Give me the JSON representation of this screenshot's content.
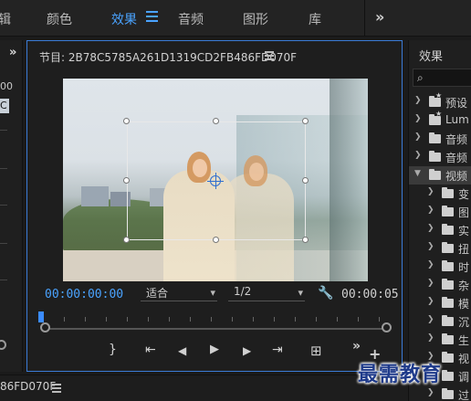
{
  "workspaces": {
    "partial_left": "辑",
    "items": [
      "颜色",
      "效果",
      "音频",
      "图形",
      "库"
    ],
    "active": "效果",
    "more": "»"
  },
  "left_panel": {
    "chevron": "»",
    "number_fragment": "00",
    "selected_fragment": "C"
  },
  "monitor": {
    "title": "节目: 2B78C5785A261D1319CD2FB486FD070F",
    "timecode_current": "00:00:00:00",
    "fit_label": "适合",
    "resolution_label": "1/2",
    "timecode_duration": "00:00:05",
    "controls": {
      "mark_in": "{",
      "mark_out": "}",
      "go_to_in": "⇤",
      "step_back": "◀",
      "play": "▶",
      "step_forward": "▶",
      "go_to_out": "⇥",
      "export_frame": "⊞",
      "more": "»",
      "add": "+"
    }
  },
  "bottom": {
    "sequence_label": "86FD070F"
  },
  "effects_panel": {
    "title": "效果",
    "search_icon": "⌕",
    "items": [
      {
        "label": "预设",
        "level": 0,
        "expanded": false,
        "icon": "star-folder"
      },
      {
        "label": "Lum",
        "level": 0,
        "expanded": false,
        "icon": "star-folder"
      },
      {
        "label": "音频",
        "level": 0,
        "expanded": false,
        "icon": "folder"
      },
      {
        "label": "音频",
        "level": 0,
        "expanded": false,
        "icon": "folder"
      },
      {
        "label": "视频",
        "level": 0,
        "expanded": true,
        "icon": "folder"
      },
      {
        "label": "变",
        "level": 1,
        "expanded": false,
        "icon": "folder"
      },
      {
        "label": "图",
        "level": 1,
        "expanded": false,
        "icon": "folder"
      },
      {
        "label": "实",
        "level": 1,
        "expanded": false,
        "icon": "folder"
      },
      {
        "label": "扭",
        "level": 1,
        "expanded": false,
        "icon": "folder"
      },
      {
        "label": "时",
        "level": 1,
        "expanded": false,
        "icon": "folder"
      },
      {
        "label": "杂",
        "level": 1,
        "expanded": false,
        "icon": "folder"
      },
      {
        "label": "模",
        "level": 1,
        "expanded": false,
        "icon": "folder"
      },
      {
        "label": "沉",
        "level": 1,
        "expanded": false,
        "icon": "folder"
      },
      {
        "label": "生",
        "level": 1,
        "expanded": false,
        "icon": "folder"
      },
      {
        "label": "视",
        "level": 1,
        "expanded": false,
        "icon": "folder"
      },
      {
        "label": "调",
        "level": 1,
        "expanded": false,
        "icon": "folder"
      },
      {
        "label": "过",
        "level": 1,
        "expanded": false,
        "icon": "folder"
      }
    ]
  },
  "watermark": "最需教育"
}
